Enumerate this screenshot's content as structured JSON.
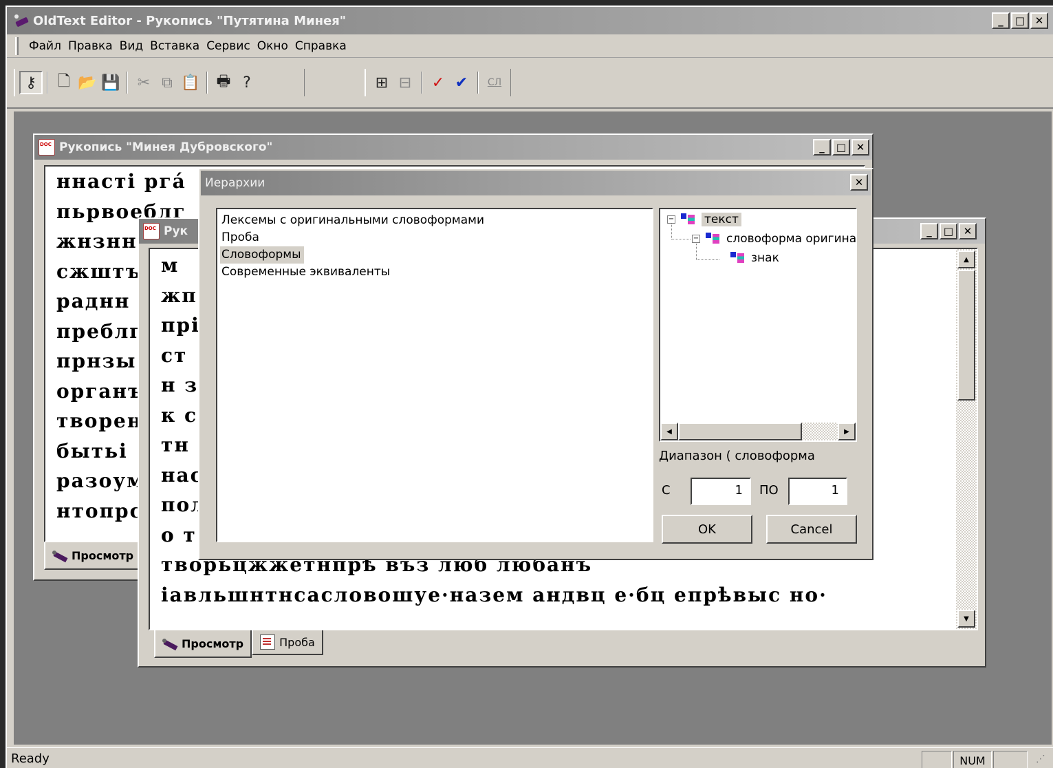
{
  "app": {
    "title": "OldText Editor - Рукопись \"Путятина Минея\"",
    "minimize": "_",
    "maximize": "□",
    "close": "✕"
  },
  "menu": [
    "Файл",
    "Правка",
    "Вид",
    "Вставка",
    "Сервис",
    "Окно",
    "Справка"
  ],
  "toolbar": {
    "buttons": [
      "key-icon",
      "new-document-icon",
      "open-folder-icon",
      "save-icon",
      "cut-icon",
      "copy-icon",
      "paste-icon",
      "print-icon",
      "help-icon",
      "hierarchy-icon",
      "layout-icon",
      "spellcheck-icon",
      "spellcheck-all-icon",
      "dictionary-icon"
    ],
    "dict_glyph": "СЛ"
  },
  "window_back": {
    "title": "Рукопись \"Минея Дубровского\"",
    "lines": [
      "ннасті ргá",
      "пьрвоеблг",
      "жнзнн",
      "сжштъ",
      "раднн",
      "преблг",
      "прнзы",
      "органъ",
      "творен",
      "бытьі",
      "разоум",
      "нтопрс"
    ],
    "tab_view": "Просмотр"
  },
  "window_front": {
    "title": "Рукопись \"Путятина Минея\"",
    "title_visible": "Рук",
    "lines": [
      "м",
      "жп",
      "прі",
      "ст",
      "н з",
      "к с",
      "тн",
      "нас",
      "пол",
      "о т",
      "творьцжжетнпрѣ въз люб любанъ",
      "іавльшнтнсасловошуе·назем андвц е·бц епрѣвыс но·"
    ],
    "tab_view": "Просмотр",
    "tab_probe": "Проба"
  },
  "dialog": {
    "title": "Иерархии",
    "close": "✕",
    "list_items": [
      "Лексемы с оригинальными словоформами",
      "Проба",
      "Словоформы",
      "Современные эквиваленты"
    ],
    "selected_index": 2,
    "tree": [
      "текст",
      "словоформа оригинальная",
      "знак"
    ],
    "range_label": "Диапазон ( словоформа",
    "from_label": "С",
    "from_value": "1",
    "to_label": "ПО",
    "to_value": "1",
    "ok": "OK",
    "cancel": "Cancel"
  },
  "status": {
    "text": "Ready",
    "num": "NUM"
  }
}
